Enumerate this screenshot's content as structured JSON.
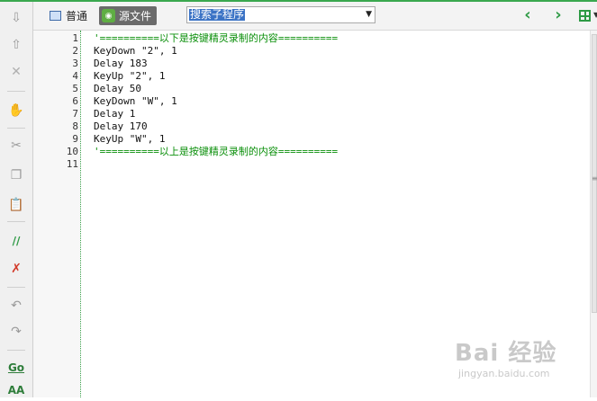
{
  "toolbar": {
    "tabs": [
      {
        "label": "普通",
        "icon": "document-icon"
      },
      {
        "label": "源文件",
        "icon": "source-file-icon"
      }
    ],
    "search_value": "搜索子程序",
    "search_dropdown_icon": "chevron-down-icon",
    "nav_prev_icon": "chevron-left-icon",
    "nav_next_icon": "chevron-right-icon",
    "layout_icon": "layout-grid-icon"
  },
  "left_toolbar": {
    "items": [
      {
        "name": "move-down-icon",
        "glyph": "⇩",
        "color": "#9a9a9a"
      },
      {
        "name": "move-up-icon",
        "glyph": "⇧",
        "color": "#9a9a9a"
      },
      {
        "name": "delete-icon",
        "glyph": "✕",
        "color": "#b0b0b0"
      },
      {
        "name": "hand-icon",
        "glyph": "✋",
        "color": "#d9822b"
      },
      {
        "name": "cut-icon",
        "glyph": "✂",
        "color": "#9a9a9a"
      },
      {
        "name": "copy-icon",
        "glyph": "❐",
        "color": "#9a9a9a"
      },
      {
        "name": "paste-icon",
        "glyph": "📋",
        "color": "#c08a2e"
      },
      {
        "name": "comment-icon",
        "glyph": "//",
        "color": "#2e9a45"
      },
      {
        "name": "uncomment-icon",
        "glyph": "✗",
        "color": "#d23a2a"
      },
      {
        "name": "undo-icon",
        "glyph": "↶",
        "color": "#9a9a9a"
      },
      {
        "name": "redo-icon",
        "glyph": "↷",
        "color": "#9a9a9a"
      },
      {
        "name": "go-icon",
        "glyph": "Go",
        "color": "#2e7d3a"
      },
      {
        "name": "find-icon",
        "glyph": "AA",
        "color": "#2e7d3a"
      }
    ]
  },
  "editor": {
    "lines": [
      {
        "no": "1",
        "text": "'==========以下是按键精灵录制的内容==========",
        "kind": "comment"
      },
      {
        "no": "2",
        "text": "KeyDown \"2\", 1",
        "kind": "code"
      },
      {
        "no": "3",
        "text": "Delay 183",
        "kind": "code"
      },
      {
        "no": "4",
        "text": "KeyUp \"2\", 1",
        "kind": "code"
      },
      {
        "no": "5",
        "text": "Delay 50",
        "kind": "code"
      },
      {
        "no": "6",
        "text": "KeyDown \"W\", 1",
        "kind": "code"
      },
      {
        "no": "7",
        "text": "Delay 1",
        "kind": "code"
      },
      {
        "no": "8",
        "text": "Delay 170",
        "kind": "code"
      },
      {
        "no": "9",
        "text": "KeyUp \"W\", 1",
        "kind": "code"
      },
      {
        "no": "10",
        "text": "'==========以上是按键精灵录制的内容==========",
        "kind": "comment"
      },
      {
        "no": "11",
        "text": "",
        "kind": "code"
      }
    ]
  },
  "watermark": {
    "main": "Bai  经验",
    "sub": "jingyan.baidu.com"
  },
  "colors": {
    "accent_green": "#2e9a45",
    "comment_green": "#0a8f0a",
    "selection_blue": "#3b73c5"
  }
}
